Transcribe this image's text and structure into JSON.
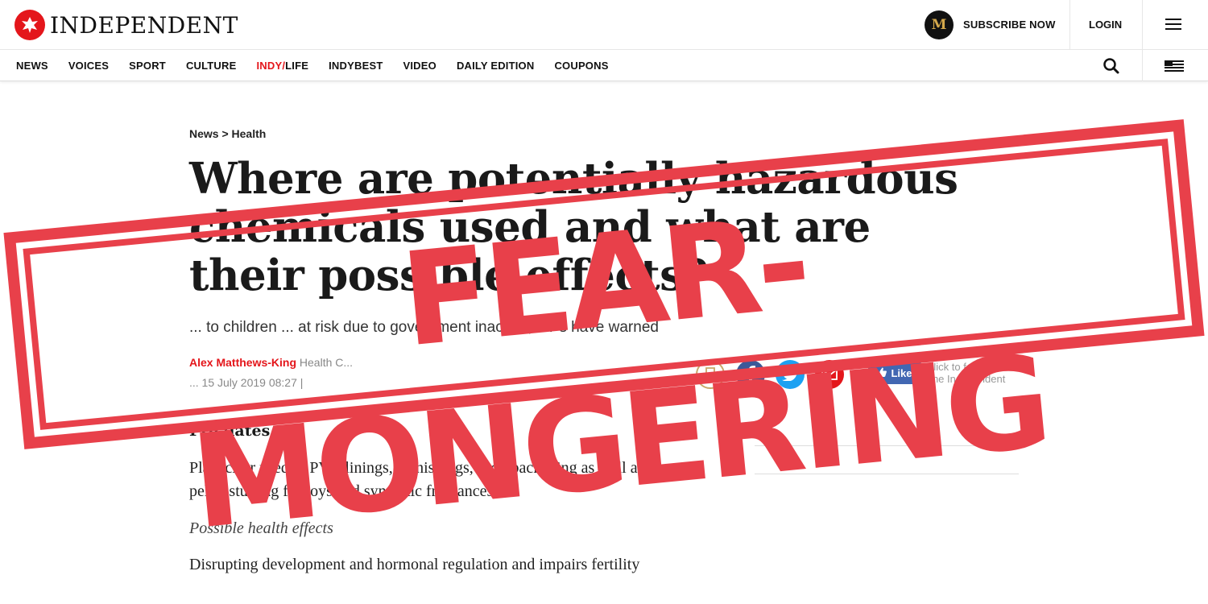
{
  "header": {
    "brand": "INDEPENDENT",
    "subscribe_label": "SUBSCRIBE NOW",
    "login_label": "LOGIN",
    "badge_letter": "M"
  },
  "nav": {
    "items": [
      {
        "label": "NEWS"
      },
      {
        "label": "VOICES"
      },
      {
        "label": "SPORT"
      },
      {
        "label": "CULTURE"
      },
      {
        "label_red": "INDY/",
        "label": "LIFE"
      },
      {
        "label": "INDYBEST"
      },
      {
        "label": "VIDEO"
      },
      {
        "label": "DAILY EDITION"
      },
      {
        "label": "COUPONS"
      }
    ]
  },
  "article": {
    "breadcrumb": "News > Health",
    "headline": "Where are potentially hazardous chemicals used and what are their possible effects?",
    "standfirst": "... to children ... at risk due to government inaction, MPs have warned",
    "author": "Alex Matthews-King",
    "author_role": "Health C...",
    "date": "... 15 July 2019 08:27 |",
    "section_title": "Pthalates",
    "paragraph_1": "Plasticiser used in PVC linings, furnishings, food packaging as well as foam pellet stuffing for toys and synthetic fragrances",
    "subheading": "Possible health effects",
    "paragraph_2": "Disrupting development and hormonal regulation and impairs fertility"
  },
  "social": {
    "like_label": "Like",
    "follow_line1": "Click to follow",
    "follow_line2": "The Independent"
  },
  "stamp": {
    "text": "FEAR-MONGERING"
  },
  "colors": {
    "brand_red": "#e4161b",
    "stamp_red": "#e8404a",
    "facebook": "#3b5998",
    "twitter": "#1da1f2",
    "email": "#e4161b",
    "bookmark_gold": "#c9a86a"
  }
}
